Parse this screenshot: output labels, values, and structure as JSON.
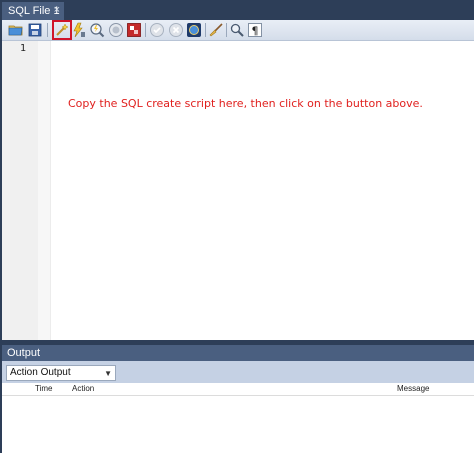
{
  "tab": {
    "title": "SQL File 1",
    "close": "×"
  },
  "toolbar": {
    "icons": [
      "open-folder-icon",
      "save-icon",
      "magic-wand-icon",
      "lightning-cursor-icon",
      "magnifier-lightning-icon",
      "stop-icon",
      "stack-icon",
      "check-icon",
      "cancel-icon",
      "globe-icon",
      "broom-icon",
      "find-icon",
      "pilcrow-icon"
    ]
  },
  "editor": {
    "line_numbers": [
      "1"
    ],
    "annotation": "Copy the SQL create script here, then click on the button above.",
    "annotation_color": "#e0201e"
  },
  "output": {
    "header": "Output",
    "select_value": "Action Output",
    "columns": [
      "Time",
      "Action",
      "Message"
    ]
  },
  "colors": {
    "frame": "#2d3e58",
    "accent": "#4a5f80",
    "highlight": "#d0142a"
  }
}
